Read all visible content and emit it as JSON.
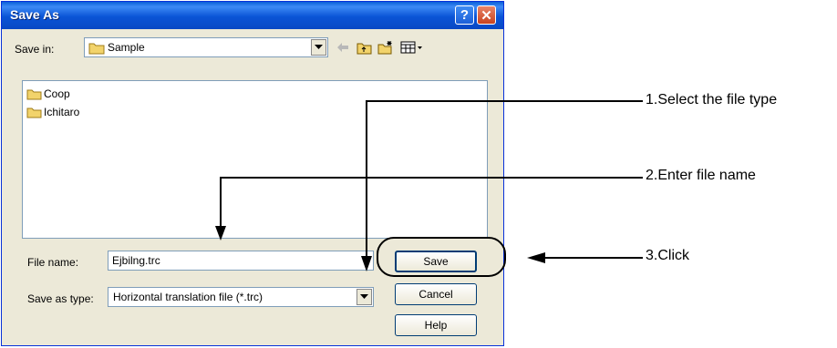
{
  "dialog": {
    "title": "Save As",
    "title_buttons": {
      "help": "?",
      "close": "✕"
    },
    "save_in": {
      "label": "Save in:",
      "value": "Sample"
    },
    "files": [
      {
        "name": "Coop",
        "icon": "folder-icon"
      },
      {
        "name": "Ichitaro",
        "icon": "folder-icon"
      }
    ],
    "file_name": {
      "label": "File name:",
      "value": "Ejbilng.trc"
    },
    "save_as_type": {
      "label": "Save as type:",
      "value": "Horizontal translation file (*.trc)"
    },
    "buttons": {
      "save": "Save",
      "cancel": "Cancel",
      "help": "Help"
    },
    "toolbar_icons": [
      "back-arrow-icon",
      "up-folder-icon",
      "new-folder-icon",
      "view-menu-icon"
    ]
  },
  "annotations": {
    "step1": "1.Select the file type",
    "step2": "2.Enter file name",
    "step3": "3.Click"
  },
  "colors": {
    "titlebar": "#0a54d6",
    "dialog_bg": "#ece9d8",
    "close": "#c9431f",
    "folder": "#f2d36b"
  }
}
